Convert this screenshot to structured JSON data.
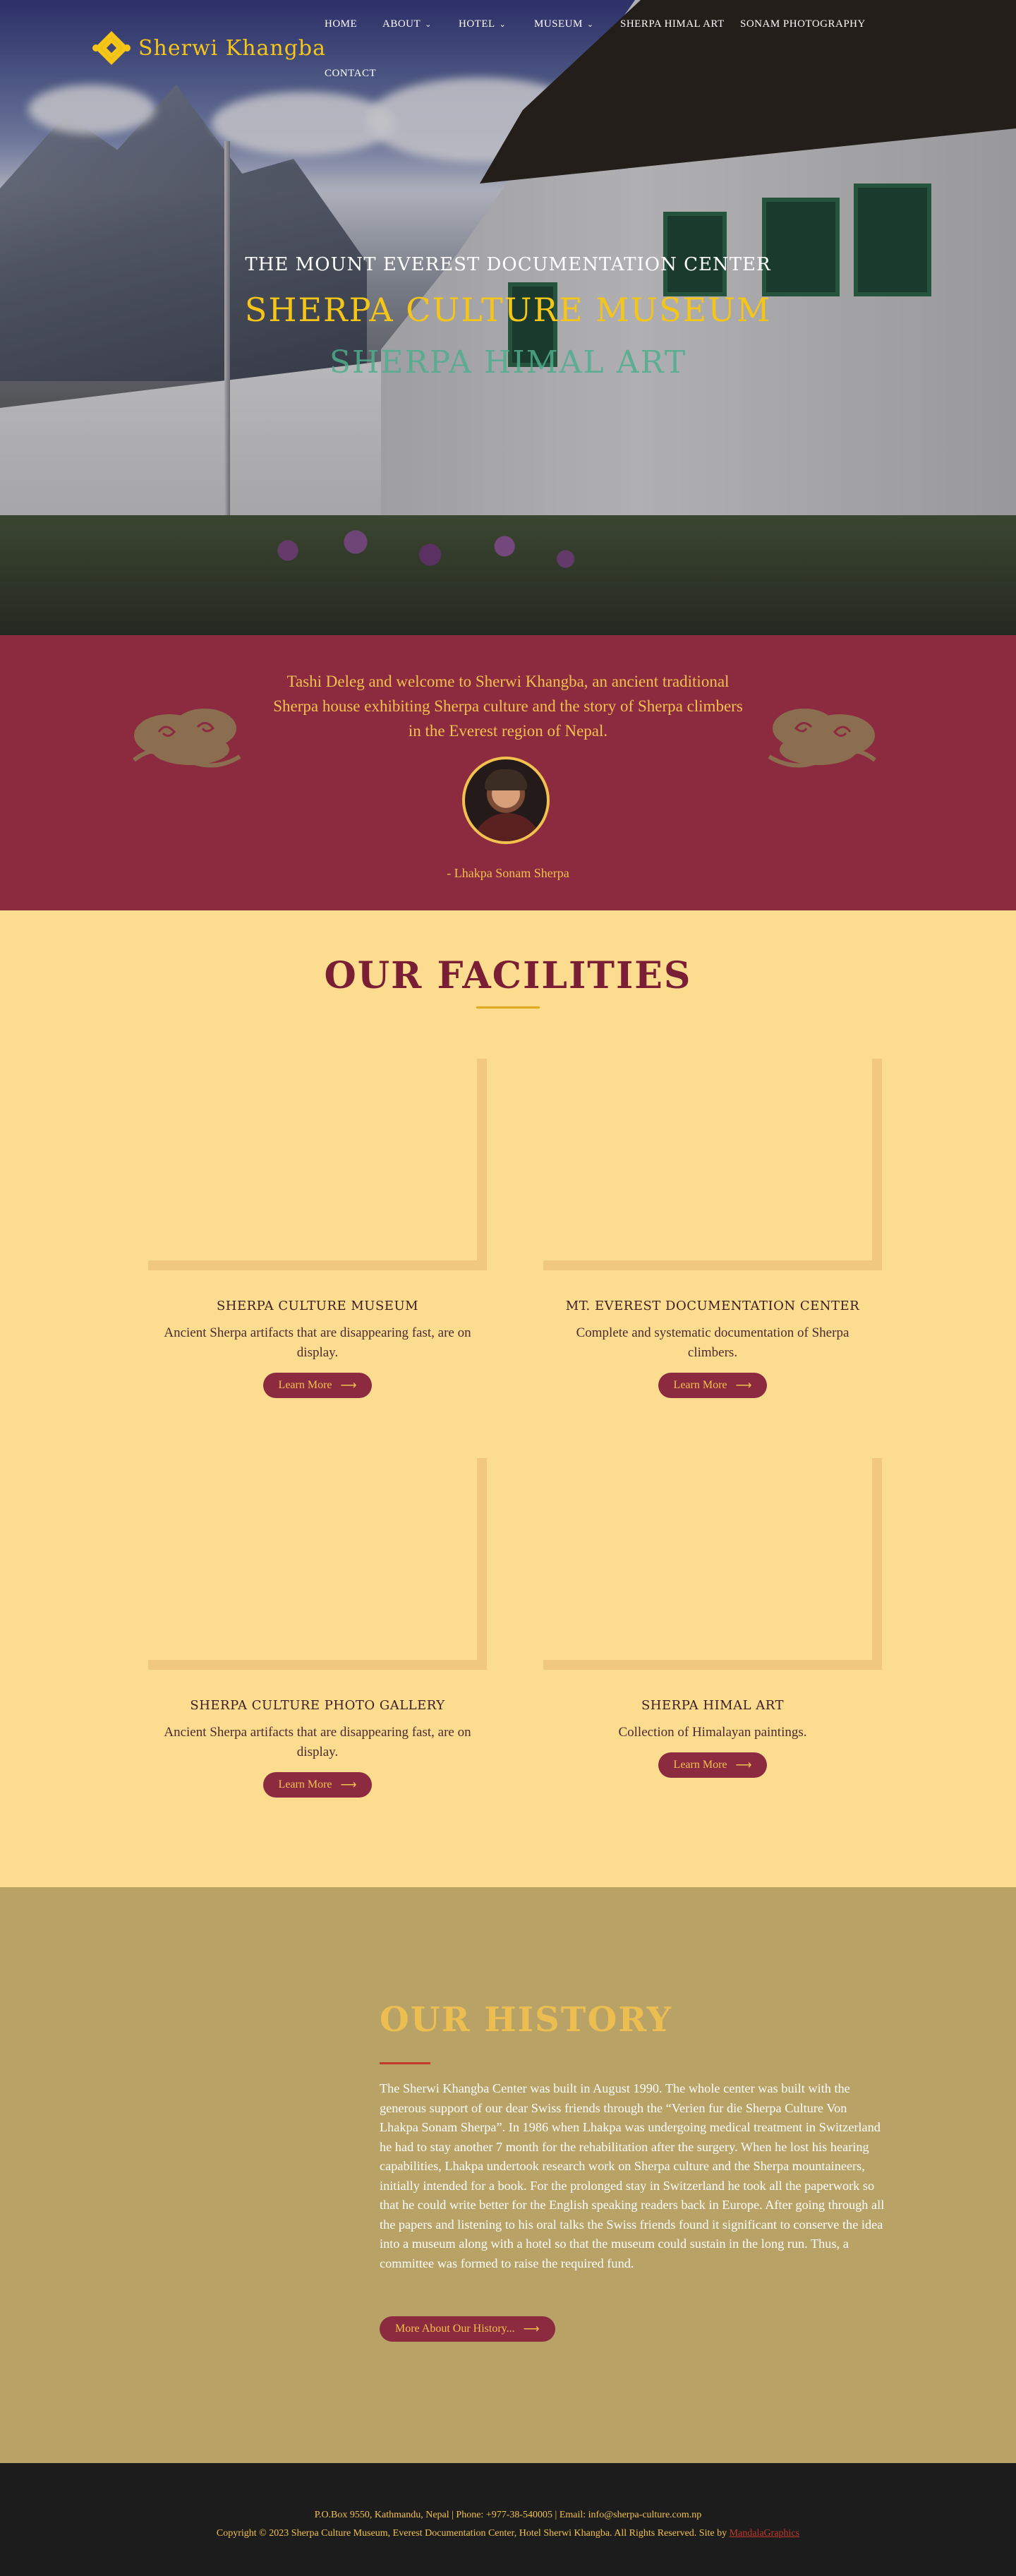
{
  "brand": {
    "name": "Sherwi Khangba",
    "logo_icon": "endless-knot-icon",
    "color": "#f5c518"
  },
  "nav": {
    "items": [
      {
        "label": "HOME",
        "has_dropdown": false
      },
      {
        "label": "ABOUT",
        "has_dropdown": true
      },
      {
        "label": "HOTEL",
        "has_dropdown": true
      },
      {
        "label": "MUSEUM",
        "has_dropdown": true
      },
      {
        "label": "SHERPA HIMAL ART",
        "has_dropdown": false
      },
      {
        "label": "SONAM PHOTOGRAPHY",
        "has_dropdown": false
      },
      {
        "label": "CONTACT",
        "has_dropdown": false
      }
    ]
  },
  "hero": {
    "subtitle": "The Mount Everest Documentation Center",
    "title": "Sherpa Culture Museum",
    "title2": "Sherpa Himal Art"
  },
  "welcome": {
    "text": "Tashi Deleg and welcome to Sherwi Khangba, an ancient traditional Sherpa house exhibiting Sherpa culture and the story of Sherpa climbers in the Everest region of Nepal.",
    "attribution": "- Lhakpa Sonam Sherpa",
    "bg_color": "#8c2a3f"
  },
  "facilities": {
    "title": "Our Facilities",
    "cards": [
      {
        "name": "Sherpa Culture Museum",
        "desc": "Ancient Sherpa artifacts that are disappearing fast, are on display.",
        "button": "Learn More"
      },
      {
        "name": "Mt. Everest Documentation Center",
        "desc": "Complete and systematic documentation of Sherpa climbers.",
        "button": "Learn More"
      },
      {
        "name": "Sherpa Culture Photo Gallery",
        "desc": "Ancient Sherpa artifacts that are disappearing fast, are on display.",
        "button": "Learn More"
      },
      {
        "name": "Sherpa Himal Art",
        "desc": "Collection of Himalayan paintings.",
        "button": "Learn More"
      }
    ],
    "bg_color": "#fcdc8e"
  },
  "history": {
    "title": "Our History",
    "body": "The Sherwi Khangba Center was built in August 1990. The whole center was built with the generous support of our dear Swiss friends through the “Verien fur die Sherpa Culture Von Lhakpa Sonam Sherpa”. In 1986 when Lhakpa was undergoing medical treatment in Switzerland he had to stay another 7 month for the rehabilitation after the surgery. When he lost his hearing capabilities, Lhakpa undertook research work on Sherpa culture and the Sherpa mountaineers, initially intended for a book. For the prolonged stay in Switzerland he took all the paperwork so that he could write better for the English speaking readers back in Europe. After going through all the papers and listening to his oral talks the Swiss friends found it significant to conserve the idea into a museum along with a hotel so that the museum could sustain in the long run. Thus, a committee was formed to raise the required fund.",
    "button": "More About Our History...",
    "bg_color": "#b8a266"
  },
  "footer": {
    "line1": "P.O.Box 9550, Kathmandu, Nepal | Phone: +977-38-540005 | Email: info@sherpa-culture.com.np",
    "line2": "Copyright © 2023 Sherpa Culture Museum, Everest Documentation Center, Hotel Sherwi Khangba. All Rights Reserved. Site by",
    "credit": "MandalaGraphics"
  },
  "icons": {
    "arrow": "arrow-right-icon",
    "chevron": "chevron-down-icon"
  }
}
